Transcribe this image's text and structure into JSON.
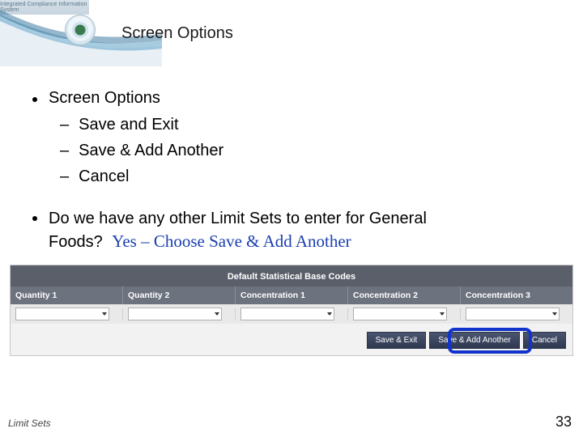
{
  "header": {
    "system_name": "Integrated Compliance Information System",
    "title": "Screen Options"
  },
  "bullets": {
    "main": "Screen Options",
    "items": [
      "Save and Exit",
      "Save & Add Another",
      "Cancel"
    ]
  },
  "question": {
    "line1": "Do we have any other Limit Sets to enter for General",
    "line2": "Foods?",
    "answer": "Yes – Choose Save & Add Another"
  },
  "table": {
    "title": "Default Statistical Base Codes",
    "columns": [
      "Quantity 1",
      "Quantity 2",
      "Concentration 1",
      "Concentration 2",
      "Concentration 3"
    ]
  },
  "buttons": {
    "save_exit": "Save & Exit",
    "save_add": "Save & Add Another",
    "cancel": "Cancel"
  },
  "footer": {
    "left": "Limit Sets",
    "page": "33"
  }
}
